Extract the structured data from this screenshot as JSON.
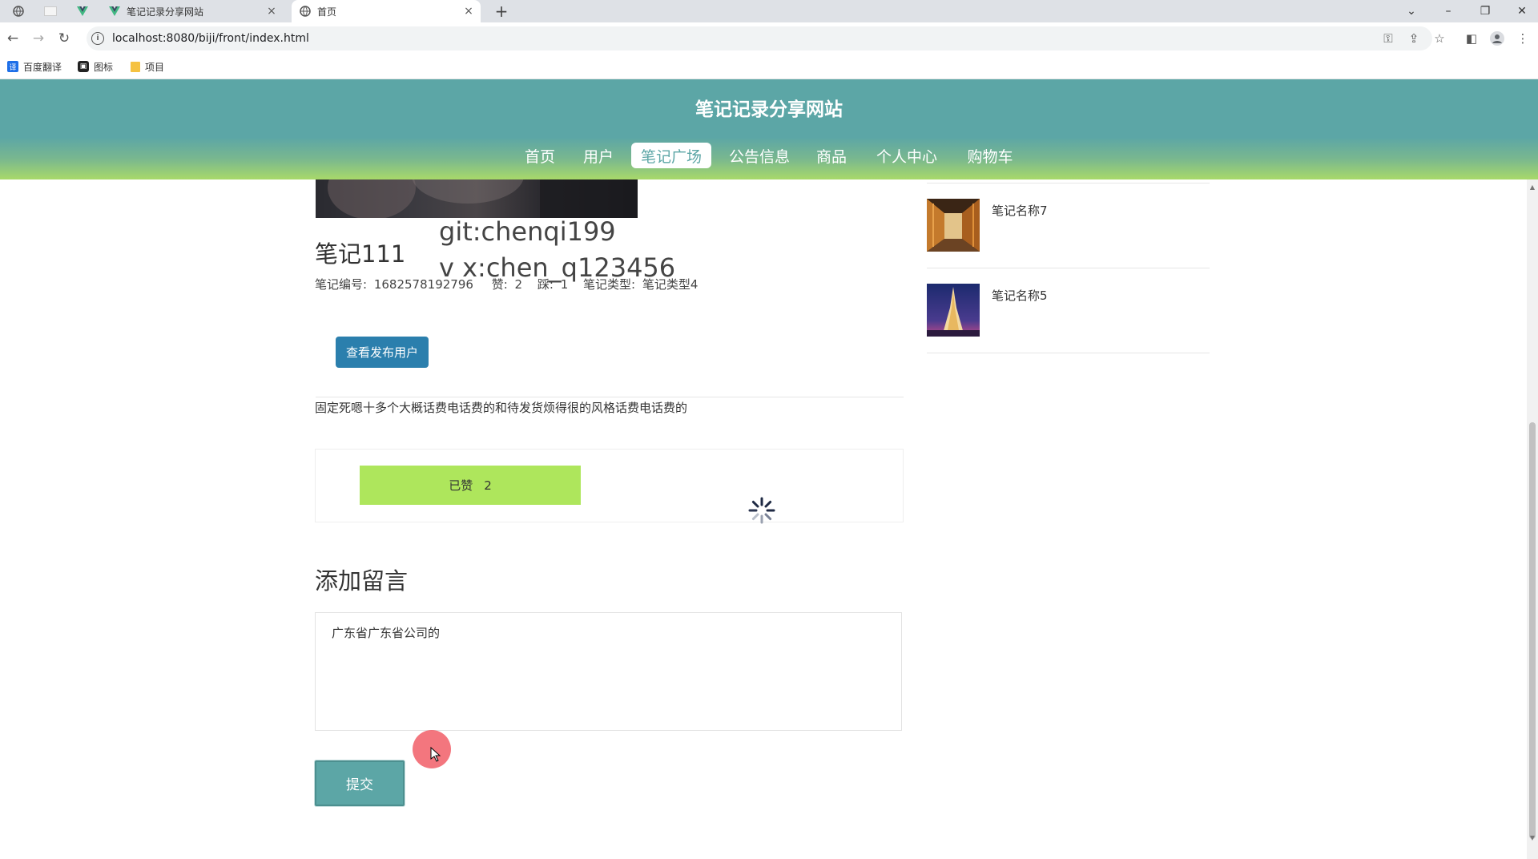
{
  "browser": {
    "tabs": [
      {
        "title": "笔记记录分享网站",
        "close": "×"
      },
      {
        "title": "首页",
        "close": "×"
      }
    ],
    "new_tab": "+",
    "url": "localhost:8080/biji/front/index.html",
    "bookmarks": [
      {
        "label": "百度翻译",
        "color": "#1e6fe8"
      },
      {
        "label": "图标",
        "color": "#222222"
      },
      {
        "label": "项目",
        "color": "#f5c242"
      }
    ]
  },
  "site": {
    "title": "笔记记录分享网站",
    "nav": [
      "首页",
      "用户",
      "笔记广场",
      "公告信息",
      "商品",
      "个人中心",
      "购物车"
    ],
    "active_nav": "笔记广场",
    "accent_color": "#5ca6a6"
  },
  "note": {
    "title": "笔记111",
    "watermark_line1": "git:chenqi199",
    "watermark_line2": "v x:chen_q123456",
    "meta": {
      "number_label": "笔记编号:",
      "number_value": "1682578192796",
      "likes_label": "赞:",
      "likes_value": "2",
      "dislikes_label": "踩:",
      "dislikes_value": "1",
      "type_label": "笔记类型:",
      "type_value": "笔记类型4"
    },
    "view_publisher_button": "查看发布用户",
    "body": "固定死嗯十多个大概话费电话费的和待发货烦得很的风格话费电话费的",
    "liked_button": "已赞",
    "liked_count": "2"
  },
  "comment": {
    "title": "添加留言",
    "input_value": "广东省广东省公司的",
    "submit_button": "提交"
  },
  "sidebar": {
    "items": [
      {
        "name": "笔记名称7"
      },
      {
        "name": "笔记名称5"
      }
    ]
  }
}
